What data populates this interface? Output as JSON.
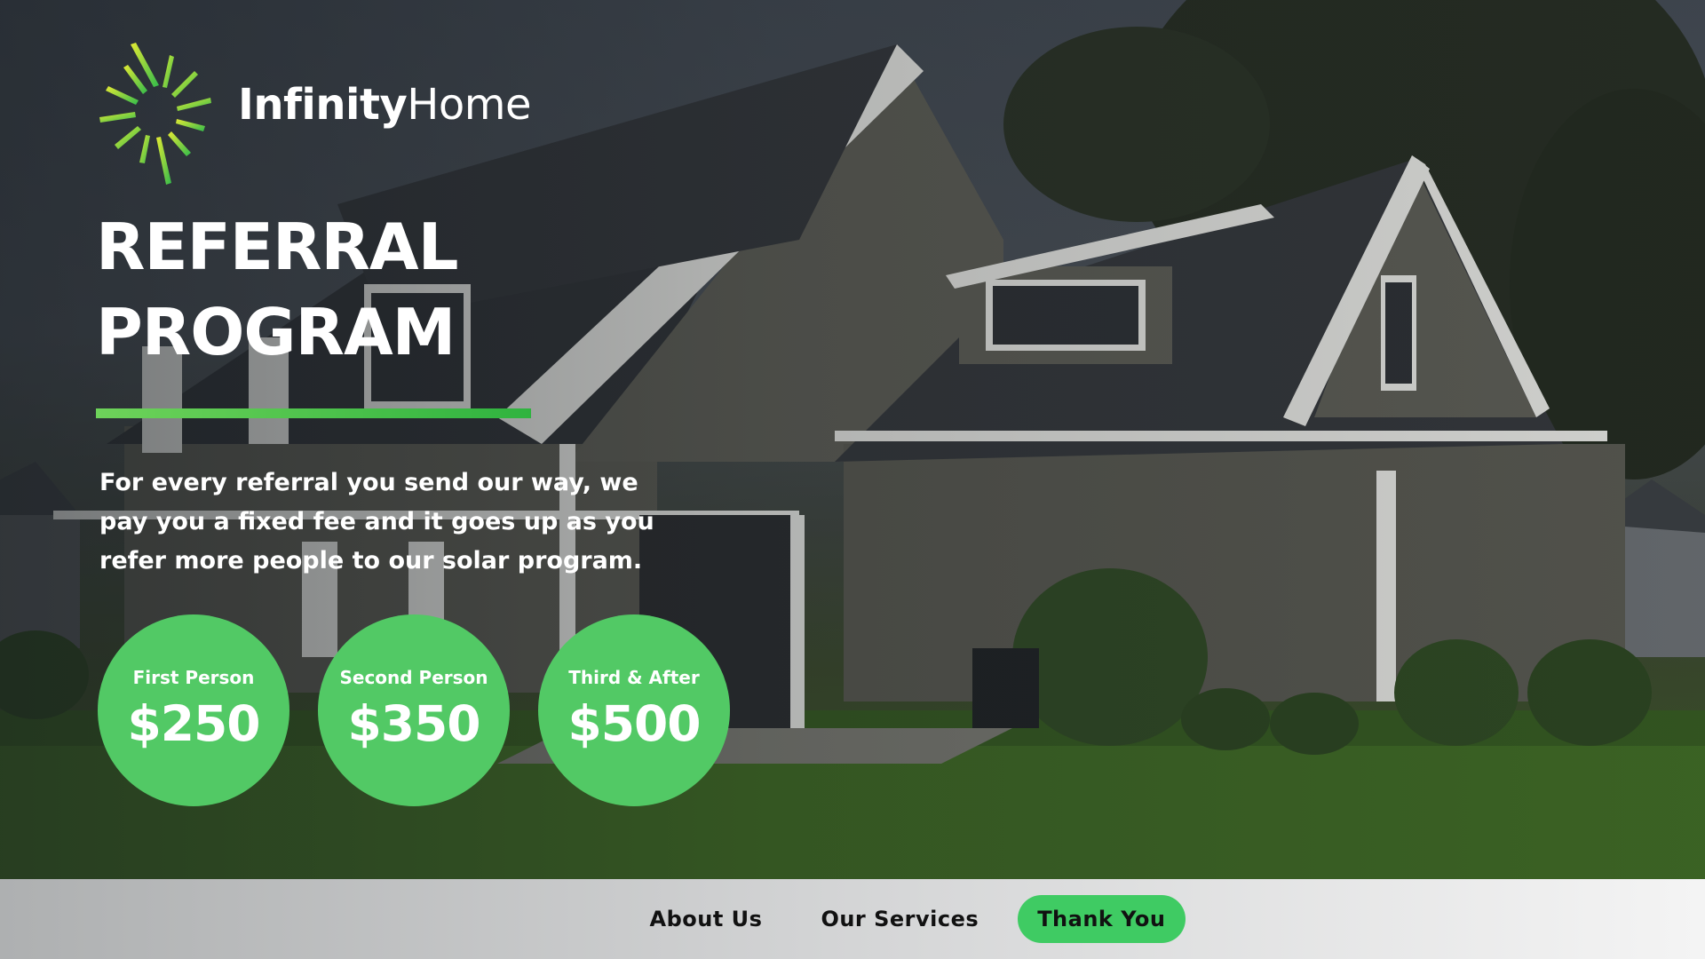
{
  "brand": {
    "name_bold": "Infinity",
    "name_light": "Home",
    "logo_icon": "sunburst-icon",
    "accent": "#52c965",
    "logo_gradient": [
      "#d8e63a",
      "#3cbf4b"
    ]
  },
  "hero": {
    "title_line1": "REFERRAL",
    "title_line2": "PROGRAM",
    "description": "For every referral you send our way, we pay you a fixed fee and it goes up as you refer more people to our solar program."
  },
  "tiers": [
    {
      "label": "First Person",
      "amount": "$250"
    },
    {
      "label": "Second Person",
      "amount": "$350"
    },
    {
      "label": "Third & After",
      "amount": "$500"
    }
  ],
  "nav": {
    "items": [
      {
        "label": "About Us",
        "active": false
      },
      {
        "label": "Our Services",
        "active": false
      },
      {
        "label": "Thank You",
        "active": true
      }
    ],
    "active_color": "#3fcb63"
  }
}
